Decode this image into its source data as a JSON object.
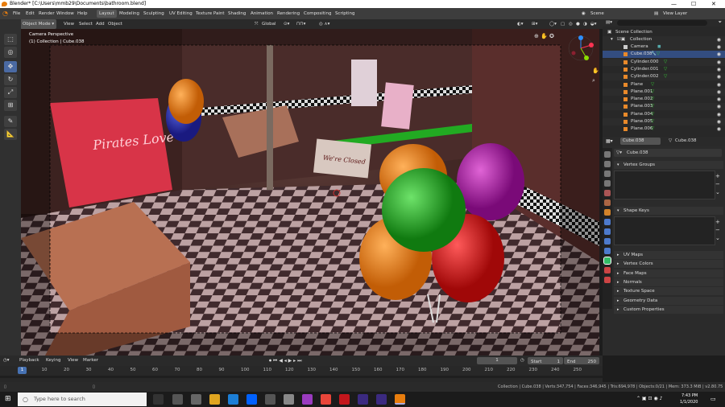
{
  "window": {
    "title": "Blender* [C:\\Users\\mmb29\\Documents\\bathroom.blend]",
    "min": "—",
    "max": "☐",
    "close": "✕"
  },
  "menu": {
    "items": [
      "File",
      "Edit",
      "Render",
      "Window",
      "Help"
    ],
    "workspaces": [
      "Layout",
      "Modeling",
      "Sculpting",
      "UV Editing",
      "Texture Paint",
      "Shading",
      "Animation",
      "Rendering",
      "Compositing",
      "Scripting"
    ],
    "scene": "Scene",
    "view_layer": "View Layer"
  },
  "viewport_header": {
    "mode": "Object Mode",
    "menus": [
      "View",
      "Select",
      "Add",
      "Object"
    ],
    "orientation": "Global"
  },
  "viewport": {
    "line1": "Camera Perspective",
    "line2": "(1) Collection | Cube.038"
  },
  "outliner": {
    "root": "Scene Collection",
    "collection": "Collection",
    "items": [
      "Camera",
      "Cube.038",
      "Cylinder.000",
      "Cylinder.001",
      "Cylinder.002",
      "Plane",
      "Plane.001",
      "Plane.002",
      "Plane.003",
      "Plane.004",
      "Plane.005",
      "Plane.006"
    ]
  },
  "properties": {
    "object_name": "Cube.038",
    "mesh_name": "Cube.038",
    "data_name": "Cube.038",
    "panels": [
      "Vertex Groups",
      "Shape Keys",
      "UV Maps",
      "Vertex Colors",
      "Face Maps",
      "Normals",
      "Texture Space",
      "Geometry Data",
      "Custom Properties"
    ]
  },
  "timeline": {
    "menus": [
      "Playback",
      "Keying",
      "View",
      "Marker"
    ],
    "current_frame": "1",
    "start_label": "Start",
    "start": "1",
    "end_label": "End",
    "end": "250",
    "ticks": [
      "0",
      "10",
      "20",
      "30",
      "40",
      "50",
      "60",
      "70",
      "80",
      "90",
      "100",
      "110",
      "120",
      "130",
      "140",
      "150",
      "160",
      "170",
      "180",
      "190",
      "200",
      "210",
      "220",
      "230",
      "240",
      "250"
    ],
    "playhead": "1"
  },
  "status": {
    "stats": "Collection | Cube.038 | Verts:347,754 | Faces:346,945 | Tris:694,978 | Objects:0/21 | Mem: 373.3 MiB | v2.80.75"
  },
  "taskbar": {
    "search_placeholder": "Type here to search",
    "time": "7:43 PM",
    "date": "1/1/2020"
  }
}
